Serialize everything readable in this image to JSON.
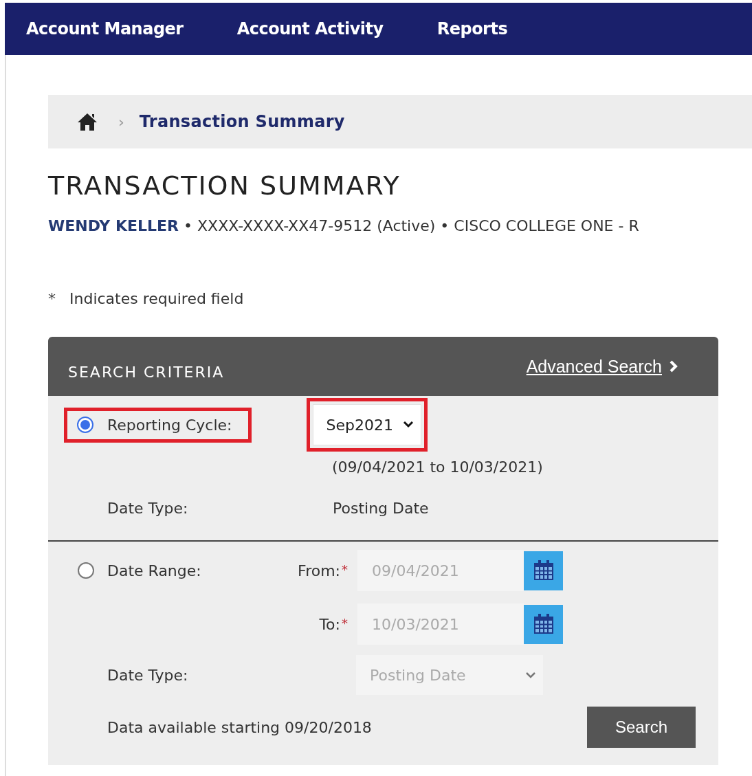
{
  "nav": {
    "items": [
      {
        "label": "Account Manager"
      },
      {
        "label": "Account Activity"
      },
      {
        "label": "Reports"
      }
    ]
  },
  "breadcrumb": {
    "separator": "›",
    "current": "Transaction Summary"
  },
  "page_title": "TRANSACTION SUMMARY",
  "account_line": {
    "name": "WENDY KELLER",
    "details": "• XXXX-XXXX-XX47-9512 (Active) • CISCO COLLEGE ONE - R"
  },
  "required_note": {
    "mark": "*",
    "text": "Indicates required field"
  },
  "search_criteria": {
    "title": "SEARCH CRITERIA",
    "advanced_link": "Advanced Search",
    "reporting_cycle": {
      "label": "Reporting Cycle:",
      "selected": true,
      "highlighted": true,
      "cycle": "Sep2021",
      "cycle_highlighted": true,
      "range_note": "(09/04/2021 to 10/03/2021)",
      "date_type_label": "Date Type:",
      "date_type_value": "Posting Date"
    },
    "date_range": {
      "label": "Date Range:",
      "selected": false,
      "disabled": true,
      "from_label": "From:",
      "from_required": "*",
      "from_value": "09/04/2021",
      "to_label": "To:",
      "to_required": "*",
      "to_value": "10/03/2021",
      "date_type_label": "Date Type:",
      "date_type_value": "Posting Date"
    },
    "availability_note": "Data available starting 09/20/2018",
    "search_button": "Search"
  }
}
